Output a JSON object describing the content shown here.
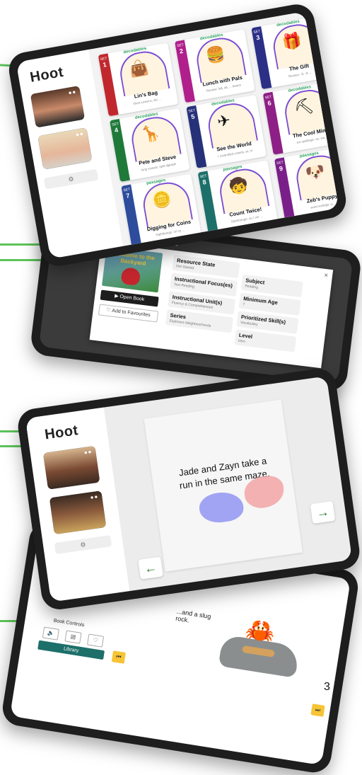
{
  "app": {
    "brand": "Hoot"
  },
  "page_number": "3",
  "library": {
    "books": [
      {
        "set": "SET",
        "num": "1",
        "tag": "decodables",
        "title": "Lin's Bag",
        "sub": "short vowel a, i/a/ ...",
        "color": "#c0282d",
        "art": "👜"
      },
      {
        "set": "SET",
        "num": "2",
        "tag": "decodables",
        "title": "Lunch with Pals",
        "sub": "Review: fall, all, ... beans",
        "color": "#b01f8c",
        "art": "🍔"
      },
      {
        "set": "SET",
        "num": "3",
        "tag": "decodables",
        "title": "The Gift",
        "sub": "Review: -ft, -lt, ...",
        "color": "#2b2f86",
        "art": "🎁"
      },
      {
        "set": "SET",
        "num": "4",
        "tag": "decodables",
        "title": "Pete and Steve",
        "sub": "long vowels: split digraph",
        "color": "#1f7a3a",
        "art": "🦒"
      },
      {
        "set": "SET",
        "num": "5",
        "tag": "decodables",
        "title": "See the World",
        "sub": "r controlled vowels, ar, or",
        "color": "#26317a",
        "art": "✈"
      },
      {
        "set": "SET",
        "num": "6",
        "tag": "decodables",
        "title": "The Cool Mine",
        "sub": "ow spellings: oo, ew...",
        "color": "#8e1f86",
        "art": "⛏"
      },
      {
        "set": "SET",
        "num": "7",
        "tag": "passages",
        "title": "Digging for Coins",
        "sub": "Diphthongs: oi/ oy ...",
        "color": "#2d4d9c",
        "art": "🪙"
      },
      {
        "set": "SET",
        "num": "8",
        "tag": "passages",
        "title": "Count Twice!",
        "sub": "Diphthongs: ou / ow ...",
        "color": "#1d6f6a",
        "art": "🧒"
      },
      {
        "set": "SET",
        "num": "9",
        "tag": "passages",
        "title": "Zeb's Puppy",
        "sub": "word endings -y ...",
        "color": "#7a1f8a",
        "art": "🐶"
      }
    ]
  },
  "resource_modal": {
    "header_fragment": "ckyard",
    "cover_title": "Welcome to the Backyard",
    "open_button": "Open Book",
    "fav_button": "Add to Favourites",
    "close": "×",
    "fields": [
      {
        "key": "Resource State",
        "value": "Not Started"
      },
      {
        "key": "Subject",
        "value": "Reading"
      },
      {
        "key": "Instructional Focus(es)",
        "value": "Text Reading"
      },
      {
        "key": "Minimum Age",
        "value": "7"
      },
      {
        "key": "Instructional Unit(s)",
        "value": "Fluency & Comprehension"
      },
      {
        "key": "Prioritized Skill(s)",
        "value": "Vocabulary"
      },
      {
        "key": "Series",
        "value": "Explorers Neighbourhoods"
      },
      {
        "key": "Level",
        "value": "Intro"
      }
    ]
  },
  "reader": {
    "brand": "Hoot",
    "page_text": "Jade and Zayn take a run in the same maze."
  },
  "controls": {
    "heading": "Book Controls",
    "library_button": "Library",
    "story_fragment": "...and a slug\nrock."
  }
}
